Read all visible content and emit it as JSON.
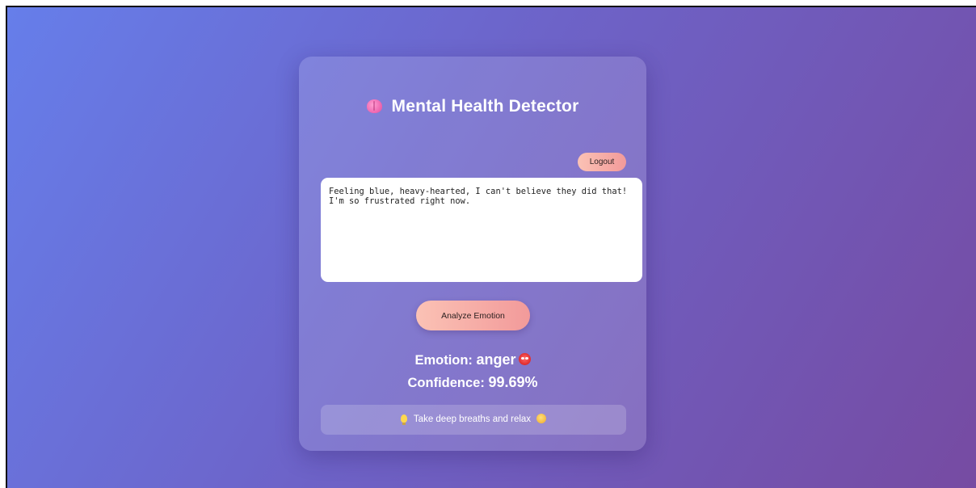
{
  "app": {
    "title": "Mental Health Detector"
  },
  "header": {
    "logout_label": "Logout"
  },
  "input": {
    "value": "Feeling blue, heavy-hearted, I can't believe they did that! I'm so frustrated right now."
  },
  "actions": {
    "analyze_label": "Analyze Emotion"
  },
  "result": {
    "emotion_label": "Emotion:",
    "emotion_value": "anger",
    "confidence_label": "Confidence:",
    "confidence_value": "99.69%"
  },
  "tip": {
    "text": "Take deep breaths and relax"
  },
  "icons": {
    "title_icon": "brain-icon",
    "emotion_icon": "angry-face-icon",
    "tip_leading_icon": "lightbulb-icon",
    "tip_trailing_icon": "relieved-face-icon"
  },
  "colors": {
    "background_start": "#667eea",
    "background_end": "#764ba2",
    "button_start": "#fbc2b5",
    "button_end": "#f29a9a"
  }
}
